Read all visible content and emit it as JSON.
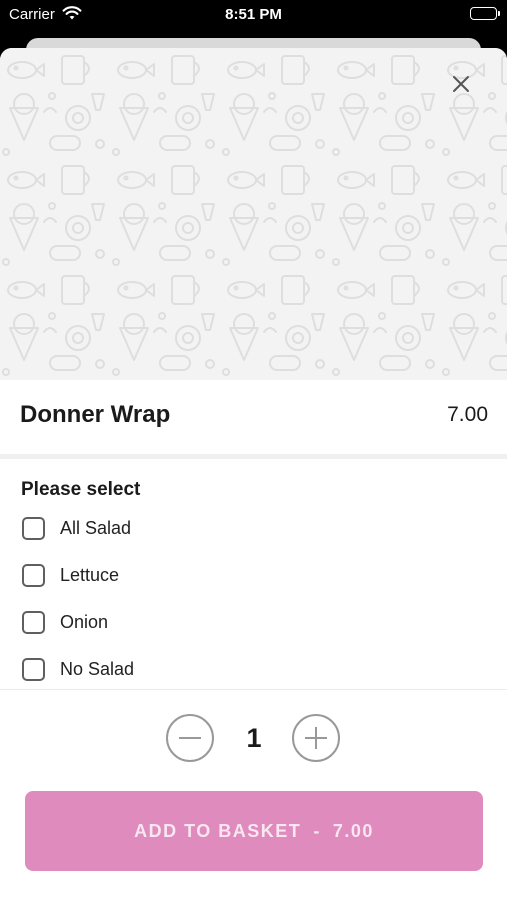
{
  "status_bar": {
    "carrier": "Carrier",
    "time": "8:51 PM"
  },
  "item": {
    "name": "Donner Wrap",
    "price": "7.00"
  },
  "options": {
    "heading": "Please select",
    "items": [
      {
        "label": "All Salad",
        "checked": false
      },
      {
        "label": "Lettuce",
        "checked": false
      },
      {
        "label": "Onion",
        "checked": false
      },
      {
        "label": "No Salad",
        "checked": false
      }
    ]
  },
  "quantity": {
    "value": "1"
  },
  "add_button": {
    "label": "ADD TO BASKET",
    "separator": "-",
    "price": "7.00"
  },
  "icons": {
    "close": "close-icon",
    "minus": "minus-icon",
    "plus": "plus-icon",
    "wifi": "wifi-icon",
    "battery": "battery-icon"
  },
  "colors": {
    "accent": "#e08bbd",
    "hero_bg": "#f3f3f3"
  }
}
